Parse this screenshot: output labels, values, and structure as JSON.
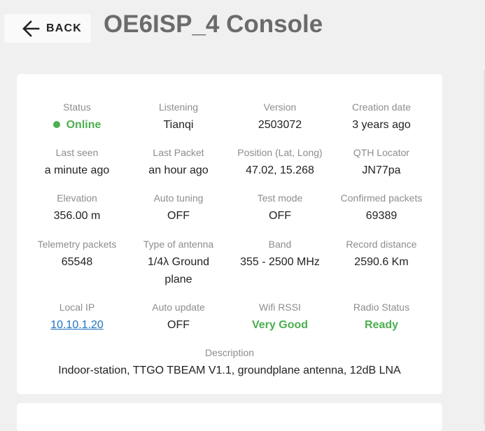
{
  "header": {
    "back_label": "BACK",
    "title": "OE6ISP_4 Console",
    "back_icon": "arrow-left-icon"
  },
  "status_indicator": {
    "icon": "status-dot-icon",
    "color": "#4caf50"
  },
  "fields": {
    "status": {
      "label": "Status",
      "value": "Online"
    },
    "listening": {
      "label": "Listening",
      "value": "Tianqi"
    },
    "version": {
      "label": "Version",
      "value": "2503072"
    },
    "creation_date": {
      "label": "Creation date",
      "value": "3 years ago"
    },
    "last_seen": {
      "label": "Last seen",
      "value": "a minute ago"
    },
    "last_packet": {
      "label": "Last Packet",
      "value": "an hour ago"
    },
    "position": {
      "label": "Position (Lat, Long)",
      "value": "47.02, 15.268"
    },
    "qth": {
      "label": "QTH Locator",
      "value": "JN77pa"
    },
    "elevation": {
      "label": "Elevation",
      "value": "356.00 m"
    },
    "auto_tuning": {
      "label": "Auto tuning",
      "value": "OFF"
    },
    "test_mode": {
      "label": "Test mode",
      "value": "OFF"
    },
    "confirmed_packets": {
      "label": "Confirmed packets",
      "value": "69389"
    },
    "telemetry_packets": {
      "label": "Telemetry packets",
      "value": "65548"
    },
    "antenna": {
      "label": "Type of antenna",
      "value_line1": "1/4λ Ground",
      "value_line2": "plane"
    },
    "band": {
      "label": "Band",
      "value": "355 - 2500 MHz"
    },
    "record_distance": {
      "label": "Record distance",
      "value": "2590.6 Km"
    },
    "local_ip": {
      "label": "Local IP",
      "value": "10.10.1.20"
    },
    "auto_update": {
      "label": "Auto update",
      "value": "OFF"
    },
    "wifi_rssi": {
      "label": "Wifi RSSI",
      "value": "Very Good"
    },
    "radio_status": {
      "label": "Radio Status",
      "value": "Ready"
    },
    "description": {
      "label": "Description",
      "value": "Indoor-station, TTGO TBEAM V1.1, groundplane antenna, 12dB LNA"
    }
  }
}
